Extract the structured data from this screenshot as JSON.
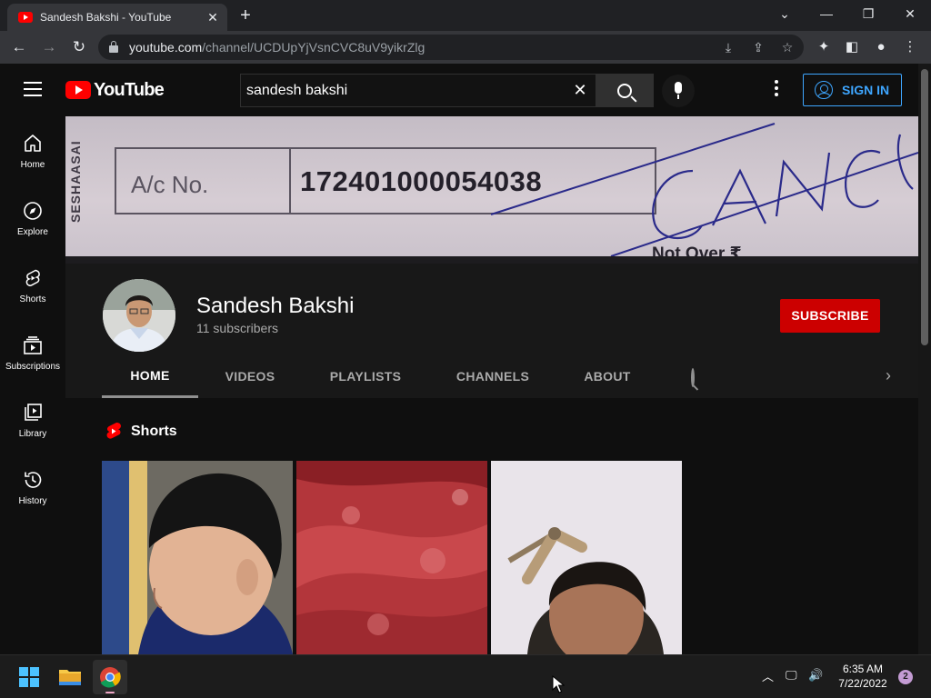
{
  "browser": {
    "tab_title": "Sandesh Bakshi - YouTube",
    "tab_close": "✕",
    "new_tab": "+",
    "window_minimize": "—",
    "window_restore": "❐",
    "window_close": "✕",
    "tab_search": "⌄",
    "url_host": "youtube.com",
    "url_path": "/channel/UCDUpYjVsnCVC8uV9yikrZlg"
  },
  "masthead": {
    "logo_word": "YouTube",
    "search_value": "sandesh bakshi",
    "search_clear": "✕",
    "sign_in": "SIGN IN"
  },
  "guide": [
    {
      "label": "Home"
    },
    {
      "label": "Explore"
    },
    {
      "label": "Shorts"
    },
    {
      "label": "Subscriptions"
    },
    {
      "label": "Library"
    },
    {
      "label": "History"
    }
  ],
  "banner": {
    "side_text": "SESHAASAI",
    "ac_label": "A/c No.",
    "ac_number": "172401000054038",
    "scrawl": "CANC",
    "bottom_text": "Not Over ₹"
  },
  "channel": {
    "name": "Sandesh Bakshi",
    "subscribers": "11 subscribers",
    "subscribe": "SUBSCRIBE",
    "tabs": [
      "HOME",
      "VIDEOS",
      "PLAYLISTS",
      "CHANNELS",
      "ABOUT"
    ],
    "active_tab": "HOME"
  },
  "content": {
    "section_title": "Shorts"
  },
  "taskbar": {
    "time": "6:35 AM",
    "date": "7/22/2022",
    "notification_count": "2"
  },
  "colors": {
    "accent_blue": "#3ea6ff",
    "subscribe_red": "#cc0000",
    "youtube_red": "#ff0000",
    "background": "#0f0f0f"
  }
}
